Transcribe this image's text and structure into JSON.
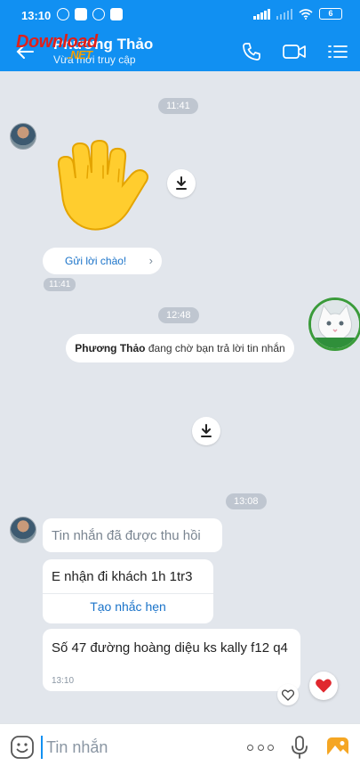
{
  "status_bar": {
    "time": "13:10",
    "battery": "6"
  },
  "header": {
    "contact_name": "Phương Thảo",
    "contact_status": "Vừa mới truy cập",
    "watermark": "Download",
    "watermark_net": ".NET"
  },
  "chat": {
    "time_1": "11:41",
    "greet_button": "Gửi lời chào!",
    "time_small": "11:41",
    "time_2": "12:48",
    "notice_name": "Phương Thảo",
    "notice_text": " đang chờ bạn trả lời tin nhắn",
    "time_3": "13:08",
    "recalled_text": "Tin nhắn đã được thu hồi",
    "reminder_message": "E nhận đi khách 1h 1tr3",
    "reminder_link": "Tạo nhắc hẹn",
    "address_message": "Số 47 đường hoàng diệu ks kally f12 q4",
    "address_time": "13:10"
  },
  "input_bar": {
    "placeholder": "Tin nhắn"
  },
  "colors": {
    "header_blue": "#1190f2",
    "chat_background": "#e2e6ec",
    "link_blue": "#1a73c9",
    "reaction_red": "#e0282e"
  },
  "icons": [
    "back-arrow-icon",
    "phone-icon",
    "video-icon",
    "menu-list-icon",
    "download-icon",
    "emoji-icon",
    "more-icon",
    "microphone-icon",
    "image-icon",
    "heart-icon"
  ]
}
